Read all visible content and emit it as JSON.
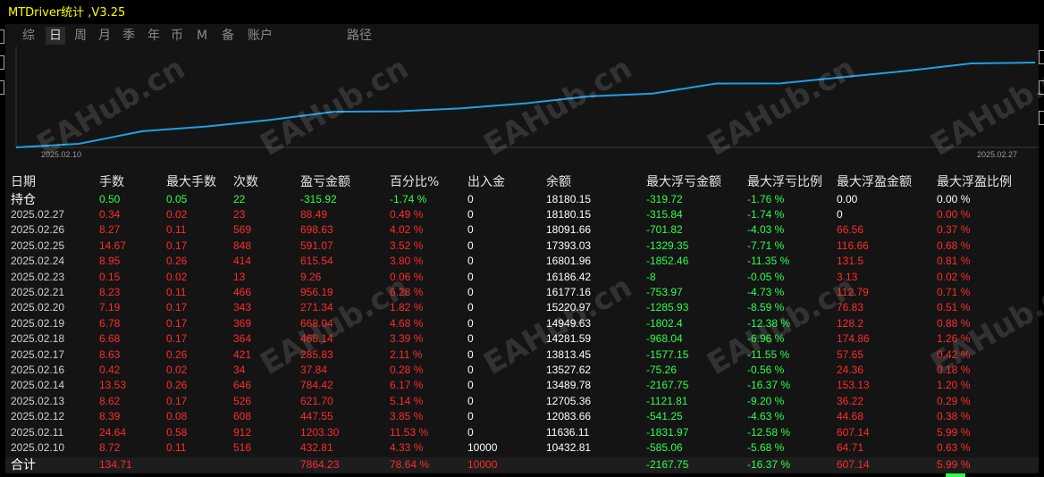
{
  "app_title": "MTDriver统计 ,V3.25",
  "tabs": [
    {
      "label": "综",
      "active": false
    },
    {
      "label": "日",
      "active": true
    },
    {
      "label": "周",
      "active": false
    },
    {
      "label": "月",
      "active": false
    },
    {
      "label": "季",
      "active": false
    },
    {
      "label": "年",
      "active": false
    },
    {
      "label": "币",
      "active": false
    },
    {
      "label": "M",
      "active": false
    },
    {
      "label": "备",
      "active": false
    },
    {
      "label": "账户",
      "active": false
    },
    {
      "label": "路径",
      "active": false
    }
  ],
  "chart_data": {
    "type": "line",
    "x": [
      "2025.02.10",
      "2025.02.11",
      "2025.02.12",
      "2025.02.13",
      "2025.02.14",
      "2025.02.16",
      "2025.02.17",
      "2025.02.18",
      "2025.02.19",
      "2025.02.20",
      "2025.02.21",
      "2025.02.23",
      "2025.02.24",
      "2025.02.25",
      "2025.02.26",
      "2025.02.27"
    ],
    "y": [
      10432.81,
      11636.11,
      12083.66,
      12705.36,
      13489.78,
      13527.62,
      13813.45,
      14281.59,
      14949.63,
      15220.97,
      16177.16,
      16186.42,
      16801.96,
      17393.03,
      18091.66,
      18180.15
    ],
    "x_tick_labels": [
      "2025.02.10",
      "2025.02.27"
    ],
    "line_color": "#1ea0e6"
  },
  "watermark": "EAHub.cn",
  "headers": [
    "日期",
    "手数",
    "最大手数",
    "次数",
    "盈亏金额",
    "百分比%",
    "出入金",
    "余额",
    "最大浮亏金额",
    "最大浮亏比例",
    "最大浮盈金额",
    "最大浮盈比例"
  ],
  "holding": {
    "date": "持仓",
    "lots": "0.50",
    "max_lots": "0.05",
    "count": "22",
    "pnl": "-315.92",
    "pct": "-1.74 %",
    "io": "0",
    "balance": "18180.15",
    "mfl": "-319.72",
    "mfl_pct": "-1.76 %",
    "mfp": "0.00",
    "mfp_pct": "0.00 %"
  },
  "rows": [
    {
      "date": "2025.02.27",
      "lots": "0.34",
      "max_lots": "0.02",
      "count": "23",
      "pnl": "88.49",
      "pct": "0.49 %",
      "io": "0",
      "balance": "18180.15",
      "mfl": "-315.84",
      "mfl_pct": "-1.74 %",
      "mfp": "0",
      "mfp_pct": "0.00 %"
    },
    {
      "date": "2025.02.26",
      "lots": "8.27",
      "max_lots": "0.11",
      "count": "569",
      "pnl": "698.63",
      "pct": "4.02 %",
      "io": "0",
      "balance": "18091.66",
      "mfl": "-701.82",
      "mfl_pct": "-4.03 %",
      "mfp": "66.56",
      "mfp_pct": "0.37 %"
    },
    {
      "date": "2025.02.25",
      "lots": "14.67",
      "max_lots": "0.17",
      "count": "848",
      "pnl": "591.07",
      "pct": "3.52 %",
      "io": "0",
      "balance": "17393.03",
      "mfl": "-1329.35",
      "mfl_pct": "-7.71 %",
      "mfp": "116.66",
      "mfp_pct": "0.68 %"
    },
    {
      "date": "2025.02.24",
      "lots": "8.95",
      "max_lots": "0.26",
      "count": "414",
      "pnl": "615.54",
      "pct": "3.80 %",
      "io": "0",
      "balance": "16801.96",
      "mfl": "-1852.46",
      "mfl_pct": "-11.35 %",
      "mfp": "131.5",
      "mfp_pct": "0.81 %"
    },
    {
      "date": "2025.02.23",
      "lots": "0.15",
      "max_lots": "0.02",
      "count": "13",
      "pnl": "9.26",
      "pct": "0.06 %",
      "io": "0",
      "balance": "16186.42",
      "mfl": "-8",
      "mfl_pct": "-0.05 %",
      "mfp": "3.13",
      "mfp_pct": "0.02 %"
    },
    {
      "date": "2025.02.21",
      "lots": "8.23",
      "max_lots": "0.11",
      "count": "466",
      "pnl": "956.19",
      "pct": "6.28 %",
      "io": "0",
      "balance": "16177.16",
      "mfl": "-753.97",
      "mfl_pct": "-4.73 %",
      "mfp": "112.79",
      "mfp_pct": "0.71 %"
    },
    {
      "date": "2025.02.20",
      "lots": "7.19",
      "max_lots": "0.17",
      "count": "343",
      "pnl": "271.34",
      "pct": "1.82 %",
      "io": "0",
      "balance": "15220.97",
      "mfl": "-1285.93",
      "mfl_pct": "-8.59 %",
      "mfp": "76.83",
      "mfp_pct": "0.51 %"
    },
    {
      "date": "2025.02.19",
      "lots": "6.78",
      "max_lots": "0.17",
      "count": "369",
      "pnl": "668.04",
      "pct": "4.68 %",
      "io": "0",
      "balance": "14949.63",
      "mfl": "-1802.4",
      "mfl_pct": "-12.38 %",
      "mfp": "128.2",
      "mfp_pct": "0.88 %"
    },
    {
      "date": "2025.02.18",
      "lots": "6.68",
      "max_lots": "0.17",
      "count": "364",
      "pnl": "468.14",
      "pct": "3.39 %",
      "io": "0",
      "balance": "14281.59",
      "mfl": "-968.04",
      "mfl_pct": "-6.96 %",
      "mfp": "174.86",
      "mfp_pct": "1.26 %"
    },
    {
      "date": "2025.02.17",
      "lots": "8.63",
      "max_lots": "0.26",
      "count": "421",
      "pnl": "285.83",
      "pct": "2.11 %",
      "io": "0",
      "balance": "13813.45",
      "mfl": "-1577.15",
      "mfl_pct": "-11.55 %",
      "mfp": "57.65",
      "mfp_pct": "0.42 %"
    },
    {
      "date": "2025.02.16",
      "lots": "0.42",
      "max_lots": "0.02",
      "count": "34",
      "pnl": "37.84",
      "pct": "0.28 %",
      "io": "0",
      "balance": "13527.62",
      "mfl": "-75.26",
      "mfl_pct": "-0.56 %",
      "mfp": "24.36",
      "mfp_pct": "0.18 %"
    },
    {
      "date": "2025.02.14",
      "lots": "13.53",
      "max_lots": "0.26",
      "count": "646",
      "pnl": "784.42",
      "pct": "6.17 %",
      "io": "0",
      "balance": "13489.78",
      "mfl": "-2167.75",
      "mfl_pct": "-16.37 %",
      "mfp": "153.13",
      "mfp_pct": "1.20 %"
    },
    {
      "date": "2025.02.13",
      "lots": "8.62",
      "max_lots": "0.17",
      "count": "526",
      "pnl": "621.70",
      "pct": "5.14 %",
      "io": "0",
      "balance": "12705.36",
      "mfl": "-1121.81",
      "mfl_pct": "-9.20 %",
      "mfp": "36.22",
      "mfp_pct": "0.29 %"
    },
    {
      "date": "2025.02.12",
      "lots": "8.39",
      "max_lots": "0.08",
      "count": "608",
      "pnl": "447.55",
      "pct": "3.85 %",
      "io": "0",
      "balance": "12083.66",
      "mfl": "-541.25",
      "mfl_pct": "-4.63 %",
      "mfp": "44.68",
      "mfp_pct": "0.38 %"
    },
    {
      "date": "2025.02.11",
      "lots": "24.64",
      "max_lots": "0.58",
      "count": "912",
      "pnl": "1203.30",
      "pct": "11.53 %",
      "io": "0",
      "balance": "11636.11",
      "mfl": "-1831.97",
      "mfl_pct": "-12.58 %",
      "mfp": "607.14",
      "mfp_pct": "5.99 %"
    },
    {
      "date": "2025.02.10",
      "lots": "8.72",
      "max_lots": "0.11",
      "count": "516",
      "pnl": "432.81",
      "pct": "4.33 %",
      "io": "10000",
      "balance": "10432.81",
      "mfl": "-585.06",
      "mfl_pct": "-5.68 %",
      "mfp": "64.71",
      "mfp_pct": "0.63 %"
    }
  ],
  "total": {
    "date": "合计",
    "lots": "134.71",
    "max_lots": "",
    "count": "",
    "pnl": "7864.23",
    "pct": "78.64 %",
    "io": "10000",
    "balance": "",
    "mfl": "-2167.75",
    "mfl_pct": "-16.37 %",
    "mfp": "607.14",
    "mfp_pct": "5.99 %"
  }
}
